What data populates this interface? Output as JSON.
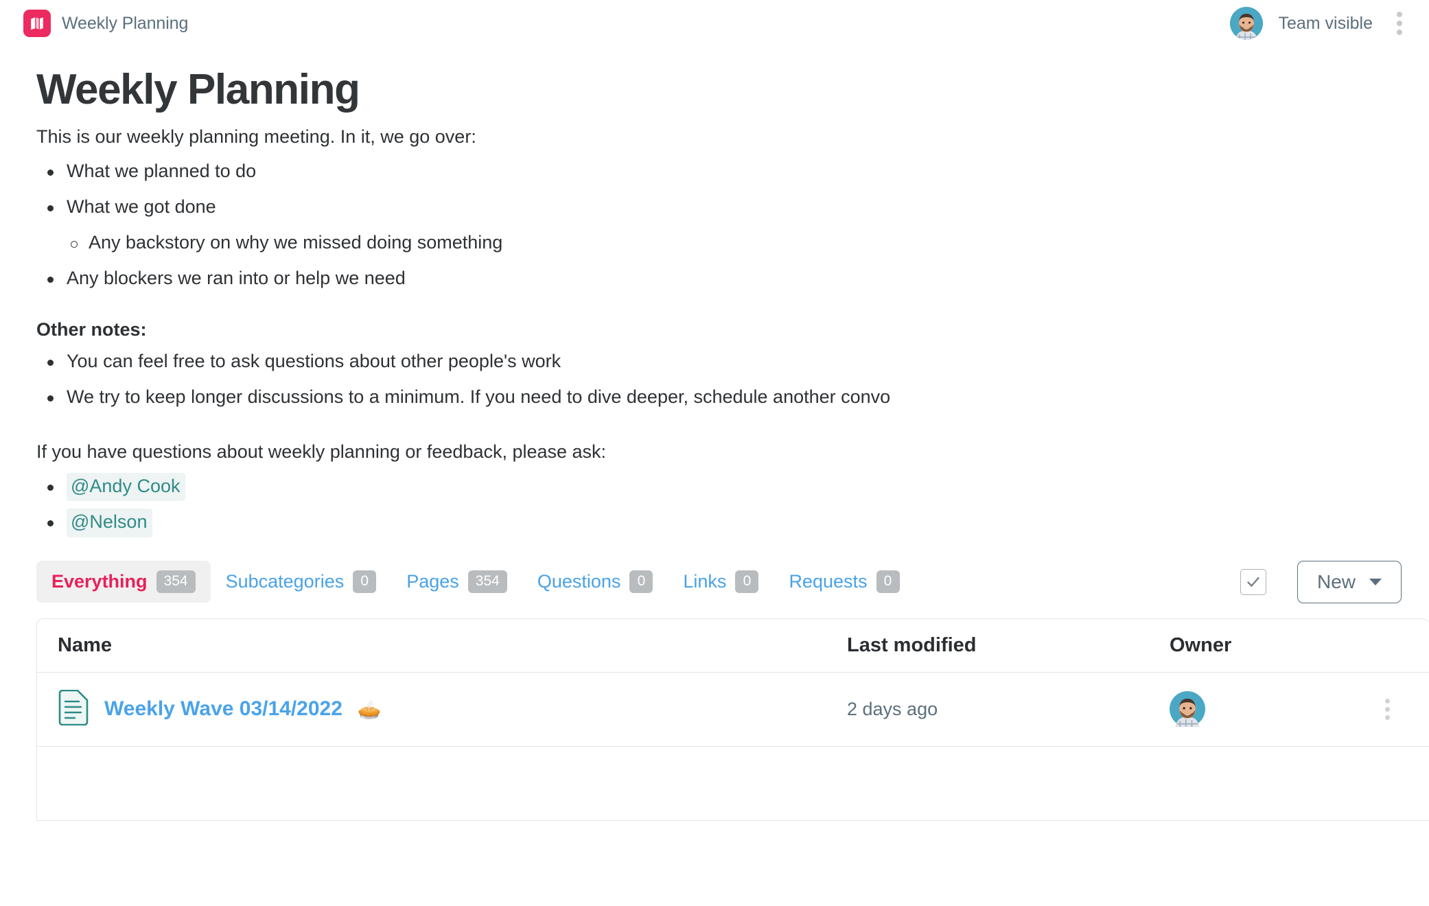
{
  "header": {
    "logo_icon": "map-book-icon",
    "brand_title": "Weekly Planning",
    "visibility_label": "Team visible",
    "avatar_name": "user-avatar",
    "menu_icon": "kebab-menu-icon",
    "brand_color": "#ec2b60"
  },
  "document": {
    "title": "Weekly Planning",
    "intro": "This is our weekly planning meeting. In it, we go over:",
    "agenda": [
      {
        "text": "What we planned to do",
        "level": 1
      },
      {
        "text": "What we got done",
        "level": 1
      },
      {
        "text": "Any backstory on why we missed doing something",
        "level": 2
      },
      {
        "text": "Any blockers we ran into or help we need",
        "level": 1
      }
    ],
    "notes_heading": "Other notes:",
    "notes": [
      "You can feel free to ask questions about other people's work",
      "We try to keep longer discussions to a minimum. If you need to dive deeper, schedule another convo"
    ],
    "contact_intro": "If you have questions about weekly planning or feedback, please ask:",
    "mentions": [
      "@Andy Cook",
      "@Nelson"
    ],
    "mention_color": "#2e8b85"
  },
  "tabs": {
    "items": [
      {
        "label": "Everything",
        "count": "354",
        "active": true
      },
      {
        "label": "Subcategories",
        "count": "0",
        "active": false
      },
      {
        "label": "Pages",
        "count": "354",
        "active": false
      },
      {
        "label": "Questions",
        "count": "0",
        "active": false
      },
      {
        "label": "Links",
        "count": "0",
        "active": false
      },
      {
        "label": "Requests",
        "count": "0",
        "active": false
      }
    ],
    "select_all_checked": true,
    "new_button_label": "New",
    "active_color": "#e8205b",
    "inactive_color": "#49a2e8"
  },
  "table": {
    "columns": [
      "Name",
      "Last modified",
      "Owner"
    ],
    "rows": [
      {
        "icon": "page-document-icon",
        "name": "Weekly Wave 03/14/2022",
        "emoji": "🥧",
        "last_modified": "2 days ago",
        "owner_avatar": "owner-avatar",
        "row_menu": "kebab-menu-icon"
      }
    ]
  }
}
